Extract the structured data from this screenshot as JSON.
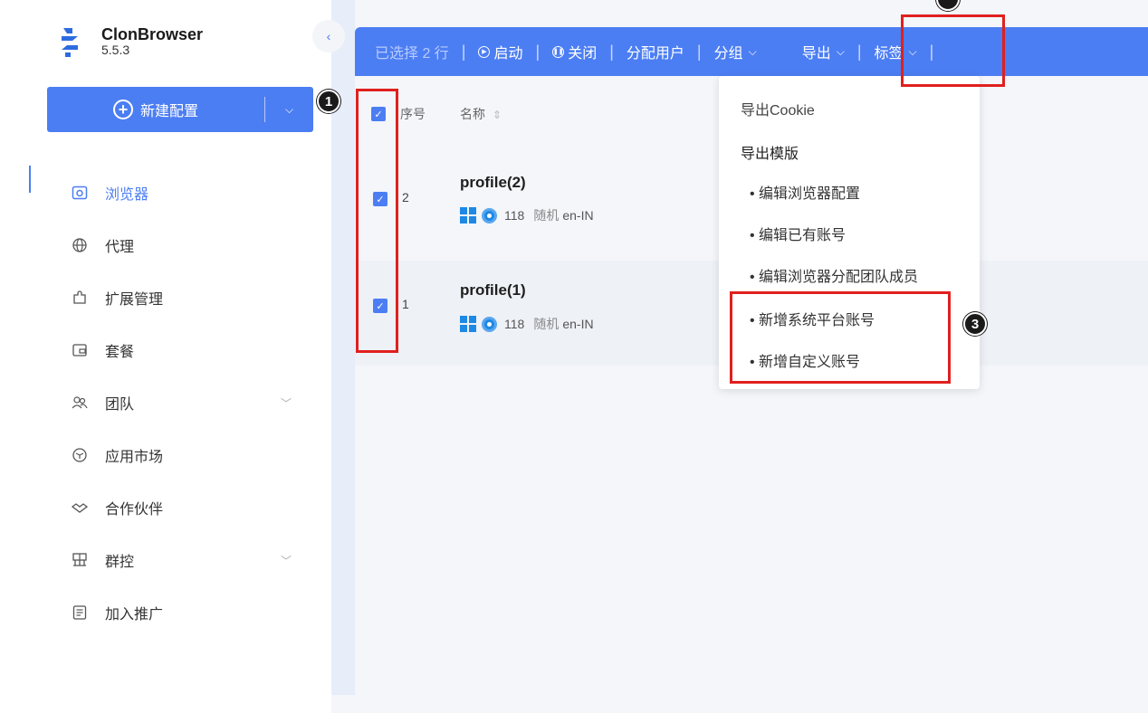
{
  "app": {
    "name": "ClonBrowser",
    "version": "5.5.3"
  },
  "sidebar": {
    "new_button": {
      "label": "新建配置",
      "plus": "+",
      "dropdown": "⌵"
    },
    "collapse": "‹",
    "items": [
      {
        "label": "浏览器",
        "icon": "browser-icon",
        "active": true
      },
      {
        "label": "代理",
        "icon": "globe-icon"
      },
      {
        "label": "扩展管理",
        "icon": "puzzle-icon"
      },
      {
        "label": "套餐",
        "icon": "wallet-icon"
      },
      {
        "label": "团队",
        "icon": "team-icon",
        "chevron": "﹀"
      },
      {
        "label": "应用市场",
        "icon": "cube-icon"
      },
      {
        "label": "合作伙伴",
        "icon": "handshake-icon"
      },
      {
        "label": "群控",
        "icon": "grid-control-icon",
        "chevron": "﹀"
      },
      {
        "label": "加入推广",
        "icon": "promo-icon"
      }
    ]
  },
  "action_bar": {
    "selected": "已选择 2 行",
    "start": "启动",
    "close": "关闭",
    "assign_user": "分配用户",
    "group": "分组",
    "export": "导出",
    "tags": "标签",
    "chev": "⌵",
    "sep": "|"
  },
  "table": {
    "columns": {
      "index": "序号",
      "name": "名称",
      "sort": "⇕"
    },
    "rows": [
      {
        "index": "2",
        "name": "profile(2)",
        "version": "118",
        "mode": "随机",
        "lang": "en-IN"
      },
      {
        "index": "1",
        "name": "profile(1)",
        "version": "118",
        "mode": "随机",
        "lang": "en-IN"
      }
    ]
  },
  "export_menu": {
    "cookie": "导出Cookie",
    "template": "导出模版",
    "items": [
      "• 编辑浏览器配置",
      "• 编辑已有账号",
      "• 编辑浏览器分配团队成员",
      "• 新增系统平台账号",
      "• 新增自定义账号"
    ]
  },
  "annotations": {
    "step1": "1",
    "step3": "3"
  },
  "colors": {
    "accent": "#4c7ef3",
    "highlight": "#e0201e"
  }
}
